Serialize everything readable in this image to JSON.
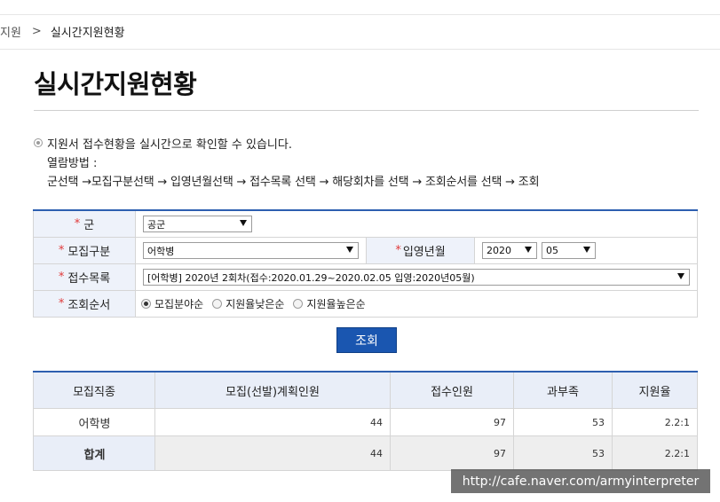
{
  "breadcrumb": {
    "prev": "지원",
    "sep": ">",
    "current": "실시간지원현황"
  },
  "page_title": "실시간지원현황",
  "info": {
    "line1": "지원서 접수현황을 실시간으로 확인할 수 있습니다.",
    "line2": "열람방법 :",
    "line3": "군선택 →모집구분선택 → 입영년월선택 → 접수목록 선택 → 해당회차를 선택 → 조회순서를 선택 → 조회"
  },
  "form": {
    "army": {
      "label": "군",
      "value": "공군"
    },
    "category": {
      "label": "모집구분",
      "value": "어학병"
    },
    "enlist": {
      "label": "입영년월",
      "year": "2020",
      "month": "05"
    },
    "reception": {
      "label": "접수목록",
      "value": "[어학병] 2020년 2회차(접수:2020.01.29~2020.02.05 입영:2020년05월)"
    },
    "order": {
      "label": "조회순서",
      "options": [
        "모집분야순",
        "지원율낮은순",
        "지원율높은순"
      ],
      "selected": "모집분야순"
    }
  },
  "search_button": "조회",
  "table": {
    "headers": [
      "모집직종",
      "모집(선발)계획인원",
      "접수인원",
      "과부족",
      "지원율"
    ],
    "rows": [
      [
        "어학병",
        "44",
        "97",
        "53",
        "2.2:1"
      ]
    ],
    "total": [
      "합계",
      "44",
      "97",
      "53",
      "2.2:1"
    ]
  },
  "watermark": "http://cafe.naver.com/armyinterpreter"
}
